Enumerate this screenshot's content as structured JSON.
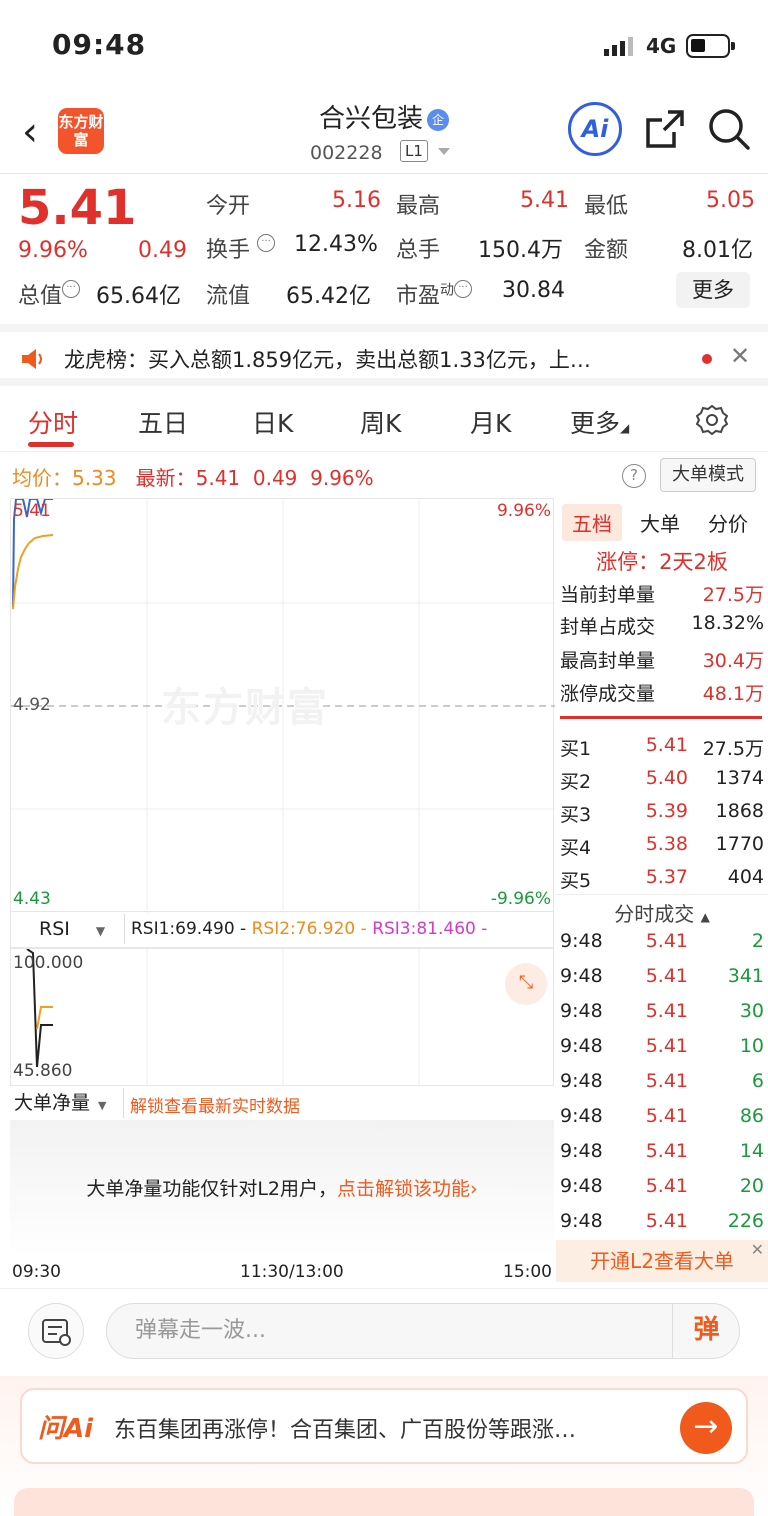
{
  "status_bar": {
    "time": "09:48",
    "network": "4G"
  },
  "nav": {
    "back": "‹",
    "logo_text": "东方财富",
    "stock_name": "合兴包装",
    "tag": "企",
    "code": "002228",
    "level": "L1",
    "ai_label": "Ai"
  },
  "quote": {
    "price": "5.41",
    "pct": "9.96%",
    "change": "0.49",
    "open_label": "今开",
    "open": "5.16",
    "high_label": "最高",
    "high": "5.41",
    "low_label": "最低",
    "low": "5.05",
    "turnover_label": "换手",
    "turnover": "12.43%",
    "volume_label": "总手",
    "volume": "150.4万",
    "amount_label": "金额",
    "amount": "8.01亿",
    "mcap_label": "总值",
    "mcap": "65.64亿",
    "float_label": "流值",
    "float": "65.42亿",
    "pe_label": "市盈",
    "pe_sup": "动",
    "pe": "30.84",
    "more_button": "更多"
  },
  "dragon": {
    "text": "龙虎榜：买入总额1.859亿元，卖出总额1.33亿元，上…"
  },
  "tabs": [
    "分时",
    "五日",
    "日K",
    "周K",
    "月K",
    "更多"
  ],
  "info": {
    "avg_label": "均价：",
    "avg": "5.33",
    "latest_label": "最新：",
    "latest": "5.41",
    "chg": "0.49",
    "pct": "9.96%",
    "help": "?",
    "mode_button": "大单模式"
  },
  "chart": {
    "top_price": "5.41",
    "top_pct": "9.96%",
    "mid_price": "4.92",
    "bottom_price": "4.43",
    "bottom_pct": "-9.96%",
    "watermark": "东方财富",
    "rsi_select": "RSI",
    "rsi1": "RSI1:69.490 -",
    "rsi2": "RSI2:76.920 -",
    "rsi3": "RSI3:81.460 -",
    "rsi_top": "100.000",
    "rsi_bottom": "45.860",
    "flow_select": "大单净量",
    "flow_unlock": "解锁查看最新实时数据",
    "flow_msg": "大单净量功能仅针对L2用户，",
    "flow_link": "点击解锁该功能›",
    "time_start": "09:30",
    "time_mid": "11:30/13:00",
    "time_end": "15:00",
    "colors": {
      "price_line": "#3a66c8",
      "avg_line": "#f0a020",
      "up": "#e0302b",
      "down": "#1a9a3a"
    }
  },
  "panel": {
    "tabs": [
      "五档",
      "大单",
      "分价"
    ],
    "limit": "涨停：2天2板",
    "stats": [
      {
        "label": "当前封单量",
        "value": "27.5万"
      },
      {
        "label": "封单占成交",
        "value": "18.32%"
      },
      {
        "label": "最高封单量",
        "value": "30.4万"
      },
      {
        "label": "涨停成交量",
        "value": "48.1万"
      }
    ],
    "bids": [
      {
        "label": "买1",
        "price": "5.41",
        "vol": "27.5万"
      },
      {
        "label": "买2",
        "price": "5.40",
        "vol": "1374"
      },
      {
        "label": "买3",
        "price": "5.39",
        "vol": "1868"
      },
      {
        "label": "买4",
        "price": "5.38",
        "vol": "1770"
      },
      {
        "label": "买5",
        "price": "5.37",
        "vol": "404"
      }
    ],
    "trades_title": "分时成交",
    "trades": [
      {
        "t": "9:48",
        "p": "5.41",
        "v": "2"
      },
      {
        "t": "9:48",
        "p": "5.41",
        "v": "341"
      },
      {
        "t": "9:48",
        "p": "5.41",
        "v": "30"
      },
      {
        "t": "9:48",
        "p": "5.41",
        "v": "10"
      },
      {
        "t": "9:48",
        "p": "5.41",
        "v": "6"
      },
      {
        "t": "9:48",
        "p": "5.41",
        "v": "86"
      },
      {
        "t": "9:48",
        "p": "5.41",
        "v": "14"
      },
      {
        "t": "9:48",
        "p": "5.41",
        "v": "20"
      },
      {
        "t": "9:48",
        "p": "5.41",
        "v": "226"
      }
    ],
    "l2_button": "开通L2查看大单"
  },
  "danmu": {
    "placeholder": "弹幕走一波...",
    "button": "弹"
  },
  "ask": {
    "logo": "问Ai",
    "text": "东百集团再涨停！合百集团、广百股份等跟涨…",
    "go": "→"
  }
}
